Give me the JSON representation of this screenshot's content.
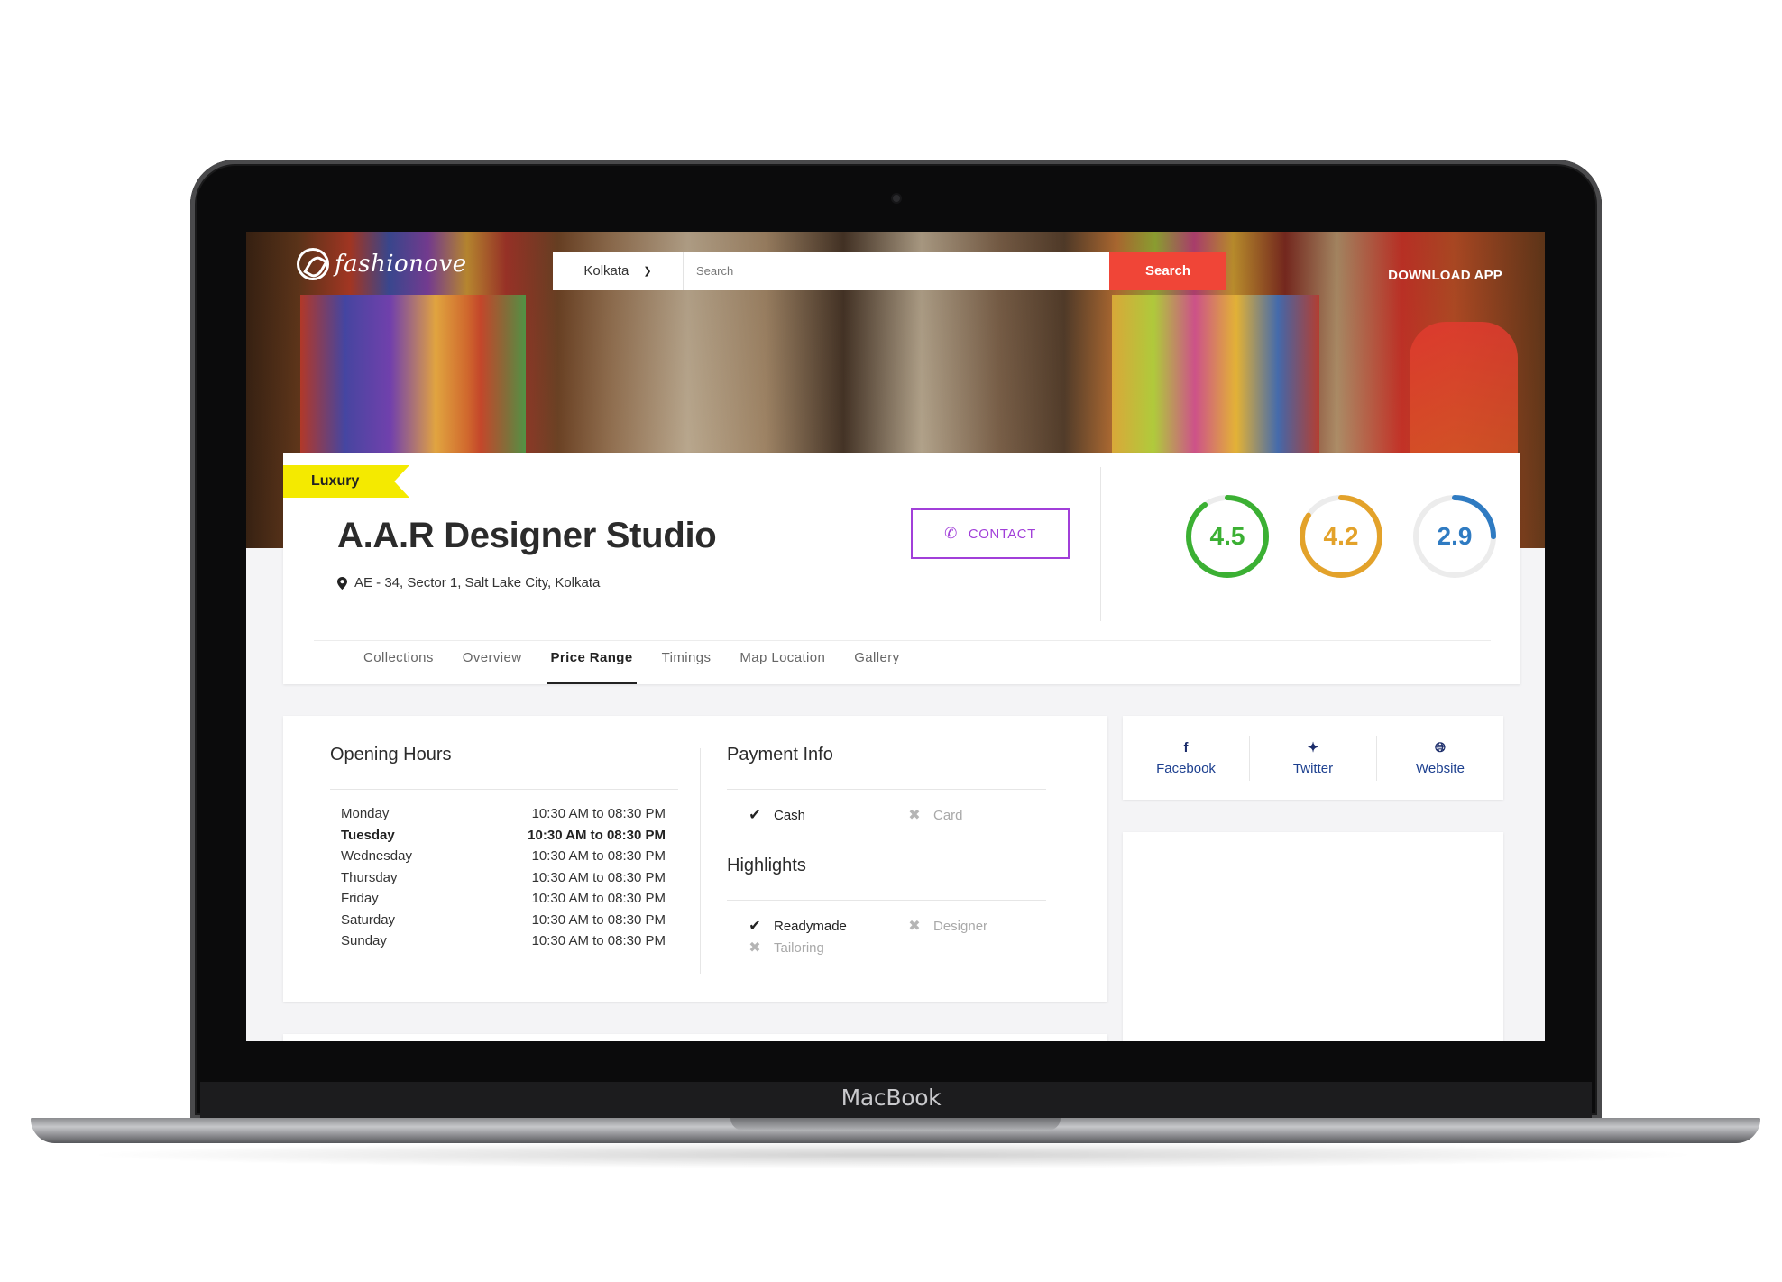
{
  "device": {
    "brand": "MacBook"
  },
  "header": {
    "logo_text": "fashionove",
    "city": "Kolkata",
    "search_placeholder": "Search",
    "search_button": "Search",
    "download_app": "DOWNLOAD APP"
  },
  "store": {
    "badge": "Luxury",
    "name": "A.A.R Designer Studio",
    "address": "AE - 34, Sector 1, Salt Lake City, Kolkata",
    "contact_label": "CONTACT",
    "ratings": [
      {
        "value": "4.5",
        "fraction": 0.9,
        "color": "#3bb033"
      },
      {
        "value": "4.2",
        "fraction": 0.84,
        "color": "#e3a22a"
      },
      {
        "value": "2.9",
        "fraction": 0.25,
        "color": "#2f7bc2"
      }
    ]
  },
  "tabs": [
    "Collections",
    "Overview",
    "Price Range",
    "Timings",
    "Map Location",
    "Gallery"
  ],
  "active_tab": "Price Range",
  "opening_hours": {
    "title": "Opening Hours",
    "rows": [
      {
        "day": "Monday",
        "time": "10:30 AM to 08:30 PM"
      },
      {
        "day": "Tuesday",
        "time": "10:30 AM to 08:30 PM"
      },
      {
        "day": "Wednesday",
        "time": "10:30 AM to 08:30 PM"
      },
      {
        "day": "Thursday",
        "time": "10:30 AM to 08:30 PM"
      },
      {
        "day": "Friday",
        "time": "10:30 AM to 08:30 PM"
      },
      {
        "day": "Saturday",
        "time": "10:30 AM to 08:30 PM"
      },
      {
        "day": "Sunday",
        "time": "10:30 AM to 08:30 PM"
      }
    ],
    "highlighted_day": "Tuesday"
  },
  "payment_info": {
    "title": "Payment Info",
    "options": [
      {
        "label": "Cash",
        "available": true
      },
      {
        "label": "Card",
        "available": false
      }
    ]
  },
  "highlights": {
    "title": "Highlights",
    "options": [
      {
        "label": "Readymade",
        "available": true
      },
      {
        "label": "Designer",
        "available": false
      },
      {
        "label": "Tailoring",
        "available": false
      }
    ]
  },
  "social": [
    {
      "label": "Facebook",
      "icon": "facebook-icon"
    },
    {
      "label": "Twitter",
      "icon": "twitter-icon"
    },
    {
      "label": "Website",
      "icon": "globe-icon"
    }
  ],
  "colors": {
    "accent": "#f04537",
    "contact": "#a13fd9",
    "badge": "#f4ea00",
    "link": "#1c3f8f"
  }
}
